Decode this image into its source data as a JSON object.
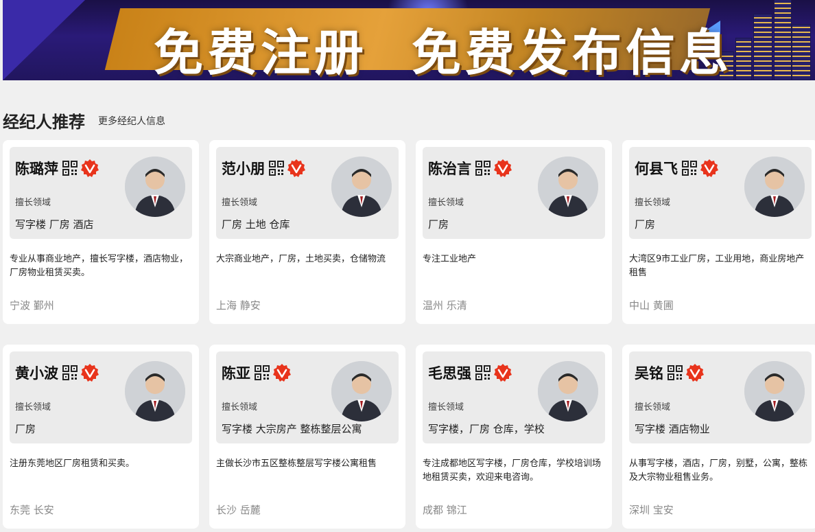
{
  "banner": {
    "slogan_left": "免费注册",
    "slogan_right": "免费发布信息"
  },
  "section": {
    "title": "经纪人推荐",
    "more_link": "更多经纪人信息"
  },
  "colors": {
    "verified": "#e8341c",
    "card_bg": "#ffffff",
    "head_bg": "#ebebeb",
    "location": "#888888"
  },
  "agents": [
    {
      "name": "陈璐萍",
      "field_label": "擅长领域",
      "fields": "写字楼 厂房 酒店",
      "desc": "专业从事商业地产，擅长写字楼，酒店物业，厂房物业租赁买卖。",
      "location": "宁波 鄞州",
      "avatar_icon": "female-agent-avatar"
    },
    {
      "name": "范小朋",
      "field_label": "擅长领域",
      "fields": "厂房 土地 仓库",
      "desc": "大宗商业地产，厂房，土地买卖，仓储物流",
      "location": "上海 静安",
      "avatar_icon": "male-agent-avatar"
    },
    {
      "name": "陈治言",
      "field_label": "擅长领域",
      "fields": "厂房",
      "desc": "专注工业地产",
      "location": "温州 乐清",
      "avatar_icon": "male-agent-avatar"
    },
    {
      "name": "何县飞",
      "field_label": "擅长领域",
      "fields": "厂房",
      "desc": "大湾区9市工业厂房，工业用地，商业房地产租售",
      "location": "中山 黄圃",
      "avatar_icon": "male-agent-avatar"
    },
    {
      "name": "黄小波",
      "field_label": "擅长领域",
      "fields": "厂房",
      "desc": "注册东莞地区厂房租赁和买卖。",
      "location": "东莞 长安",
      "avatar_icon": "male-agent-avatar"
    },
    {
      "name": "陈亚",
      "field_label": "擅长领域",
      "fields": "写字楼 大宗房产 整栋整层公寓",
      "desc": "主做长沙市五区整栋整层写字楼公寓租售",
      "location": "长沙 岳麓",
      "avatar_icon": "male-agent-avatar"
    },
    {
      "name": "毛思强",
      "field_label": "擅长领域",
      "fields": "写字楼，厂房 仓库，学校",
      "desc": "专注成都地区写字楼，厂房仓库，学校培训场地租赁买卖，欢迎来电咨询。",
      "location": "成都 锦江",
      "avatar_icon": "male-agent-avatar"
    },
    {
      "name": "吴铭",
      "field_label": "擅长领域",
      "fields": "写字楼 酒店物业",
      "desc": "从事写字楼，酒店，厂房，别墅，公寓，整栋及大宗物业租售业务。",
      "location": "深圳 宝安",
      "avatar_icon": "male-agent-avatar"
    }
  ]
}
